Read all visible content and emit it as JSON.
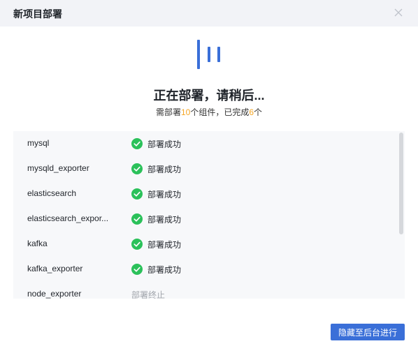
{
  "dialog": {
    "title": "新项目部署",
    "close_icon": "close-icon"
  },
  "progress": {
    "loader_icon": "loading-bars-icon",
    "heading": "正在部署，请稍后...",
    "summary_prefix": "需部署",
    "total": "10",
    "summary_middle": "个组件，已完成",
    "completed": "6",
    "summary_suffix": "个"
  },
  "components": [
    {
      "name": "mysql",
      "status": "部署成功",
      "state": "success"
    },
    {
      "name": "mysqld_exporter",
      "status": "部署成功",
      "state": "success"
    },
    {
      "name": "elasticsearch",
      "status": "部署成功",
      "state": "success"
    },
    {
      "name": "elasticsearch_expor...",
      "status": "部署成功",
      "state": "success"
    },
    {
      "name": "kafka",
      "status": "部署成功",
      "state": "success"
    },
    {
      "name": "kafka_exporter",
      "status": "部署成功",
      "state": "success"
    },
    {
      "name": "node_exporter",
      "status": "部署终止",
      "state": "stopped"
    }
  ],
  "footer": {
    "background_button": "隐藏至后台进行"
  },
  "colors": {
    "accent": "#3a6fd8",
    "success": "#2bc15a",
    "highlight": "#f5a623"
  }
}
